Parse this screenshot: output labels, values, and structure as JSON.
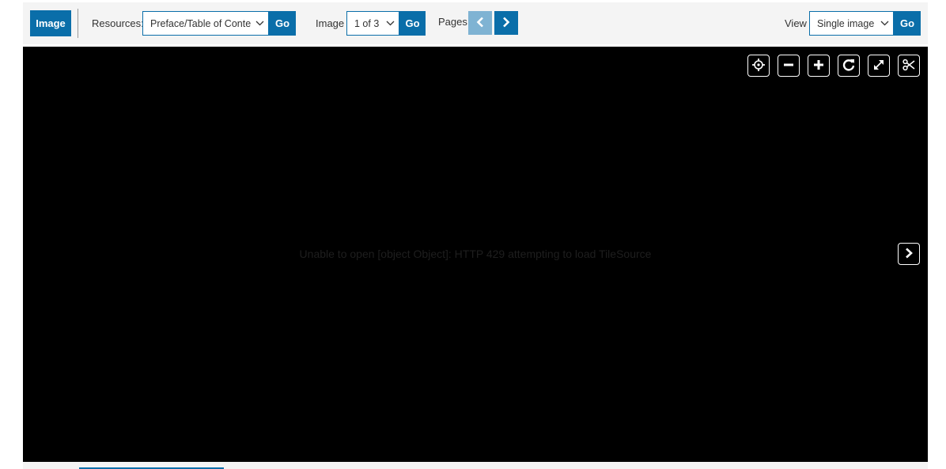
{
  "toolbar": {
    "image_tab_label": "Image",
    "resources_label": "Resources:",
    "resources_selected": "Preface/Table of Contents",
    "resources_go": "Go",
    "image_label": "Image",
    "image_selected": "1 of 3",
    "image_go": "Go",
    "pages_label": "Pages",
    "view_label": "View",
    "view_selected": "Single image",
    "view_go": "Go"
  },
  "viewer": {
    "error_message": "Unable to open [object Object]: HTTP 429 attempting to load TileSource",
    "tools": [
      "home-icon",
      "zoom-out-icon",
      "zoom-in-icon",
      "rotate-icon",
      "fullscreen-icon",
      "crop-icon"
    ]
  },
  "colors": {
    "primary": "#0a6ea9",
    "primary_disabled": "#7fb3d3",
    "toolbar_bg": "#f4f4f4",
    "viewer_bg": "#000000"
  }
}
